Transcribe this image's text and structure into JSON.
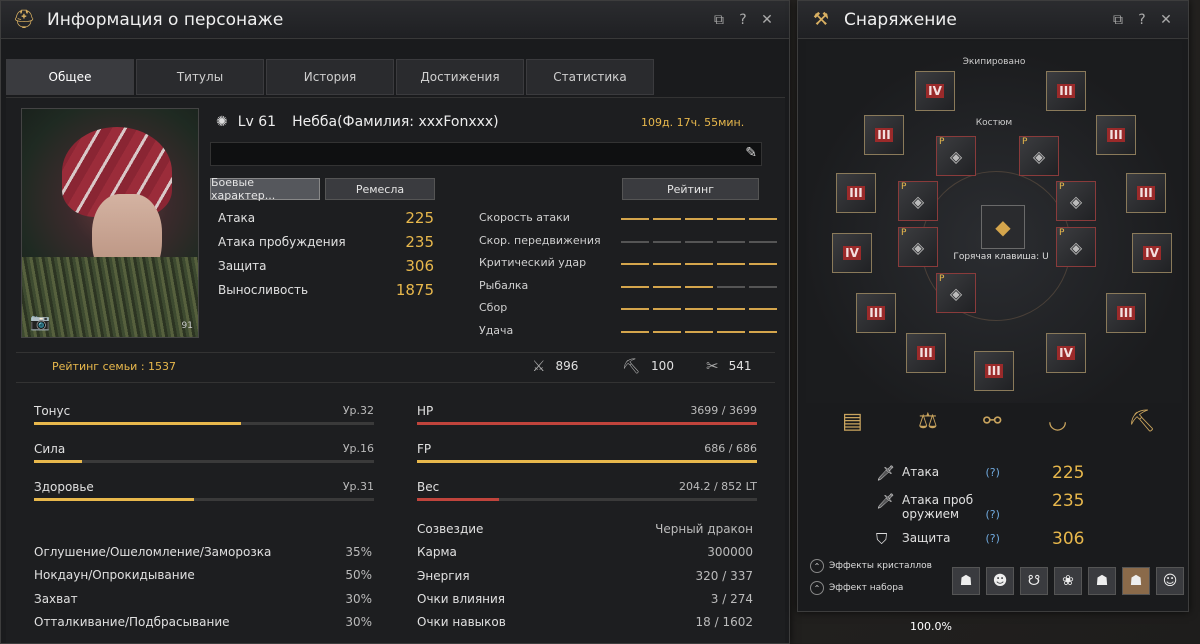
{
  "char_window": {
    "title": "Информация о персонаже",
    "tabs": [
      "Общее",
      "Титулы",
      "История",
      "Достижения",
      "Статистика"
    ],
    "level": "Lv 61",
    "name": "Небба(Фамилия: xxxFonxxx)",
    "playtime": "109д. 17ч. 55мин.",
    "buttons": {
      "combat": "Боевые характер...",
      "crafts": "Ремесла",
      "rating": "Рейтинг"
    },
    "combat_stats": [
      {
        "label": "Атака",
        "value": "225"
      },
      {
        "label": "Атака пробуждения",
        "value": "235"
      },
      {
        "label": "Защита",
        "value": "306"
      },
      {
        "label": "Выносливость",
        "value": "1875"
      }
    ],
    "grades": [
      {
        "label": "Скорость атаки",
        "lit": 5
      },
      {
        "label": "Скор. передвижения",
        "lit": 0
      },
      {
        "label": "Критический удар",
        "lit": 5
      },
      {
        "label": "Рыбалка",
        "lit": 3
      },
      {
        "label": "Сбор",
        "lit": 5
      },
      {
        "label": "Удача",
        "lit": 5
      }
    ],
    "portrait_level": "91",
    "family_rating": "Рейтинг семьи : 1537",
    "counters": [
      {
        "icon": "crossed-swords-icon",
        "glyph": "⚔",
        "value": "896"
      },
      {
        "icon": "pickaxe-icon",
        "glyph": "⛏",
        "value": "100"
      },
      {
        "icon": "tongs-icon",
        "glyph": "✂",
        "value": "541"
      }
    ],
    "life_bars": [
      {
        "label": "Тонус",
        "right": "Ур.32",
        "fill": 0.61
      },
      {
        "label": "Сила",
        "right": "Ур.16",
        "fill": 0.14
      },
      {
        "label": "Здоровье",
        "right": "Ур.31",
        "fill": 0.47
      }
    ],
    "status_bars": [
      {
        "label": "HP",
        "right": "3699 / 3699",
        "fill": 1.0,
        "color": "#c0443c"
      },
      {
        "label": "FP",
        "right": "686 / 686",
        "fill": 1.0,
        "color": "#e8b84c"
      },
      {
        "label": "Вес",
        "right": "204.2 / 852 LT",
        "fill": 0.24,
        "color": "#c0443c"
      }
    ],
    "resist": [
      {
        "label": "Оглушение/Ошеломление/Заморозка",
        "value": "35%"
      },
      {
        "label": "Нокдаун/Опрокидывание",
        "value": "50%"
      },
      {
        "label": "Захват",
        "value": "30%"
      },
      {
        "label": "Отталкивание/Подбрасывание",
        "value": "30%"
      }
    ],
    "info": [
      {
        "label": "Созвездие",
        "value": "Черный дракон"
      },
      {
        "label": "Карма",
        "value": "300000"
      },
      {
        "label": "Энергия",
        "value": "320 / 337"
      },
      {
        "label": "Очки влияния",
        "value": "3 / 274"
      },
      {
        "label": "Очки навыков",
        "value": "18 / 1602"
      }
    ]
  },
  "equip_window": {
    "title": "Снаряжение",
    "equipped_label": "Экипировано",
    "costume_label": "Костюм",
    "hotkey": "Горячая клавиша: U",
    "gear_grades": [
      "IV",
      "III",
      "III",
      "III",
      "III",
      "III",
      "IV",
      "IV",
      "III",
      "III",
      "III",
      "IV",
      "III"
    ],
    "stats": [
      {
        "label": "Атака",
        "value": "225"
      },
      {
        "label": "Атака проб оружием",
        "value": "235"
      },
      {
        "label": "Защита",
        "value": "306"
      }
    ],
    "crystal_effects": "Эффекты кристаллов",
    "set_effect": "Эффект набора",
    "bottom_pct": "100.0%"
  }
}
